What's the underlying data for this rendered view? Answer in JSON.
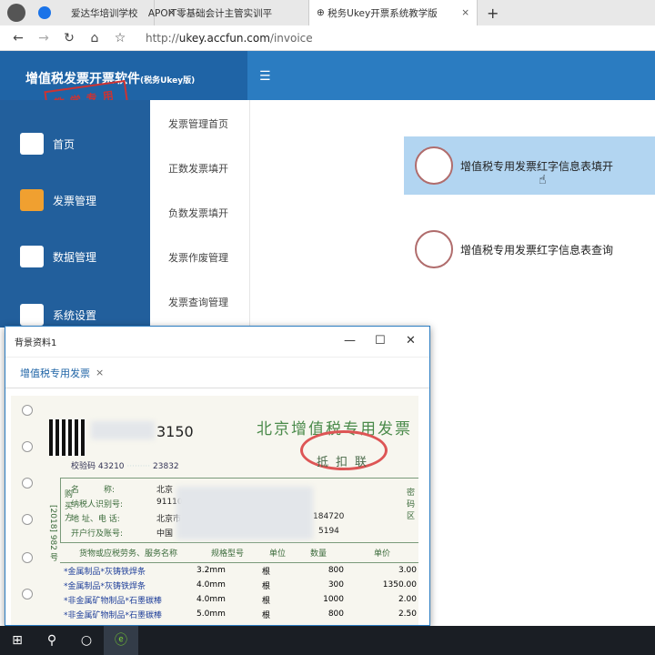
{
  "browser": {
    "tabs": [
      {
        "label": "爱达华培训学校"
      },
      {
        "label": "APOIT零基础会计主管实训平"
      },
      {
        "label": "税务Ukey开票系统教学版"
      }
    ],
    "url_prefix": "http://",
    "url_host": "ukey.accfun.com",
    "url_path": "/invoice"
  },
  "app": {
    "title": "增值税发票开票软件",
    "title_suffix": "(税务Ukey版)",
    "stamp": "教学专用"
  },
  "sidebar": {
    "items": [
      {
        "label": "首页"
      },
      {
        "label": "发票管理"
      },
      {
        "label": "数据管理"
      },
      {
        "label": "系统设置"
      }
    ]
  },
  "submenu": {
    "items": [
      {
        "label": "发票管理首页"
      },
      {
        "label": "正数发票填开"
      },
      {
        "label": "负数发票填开"
      },
      {
        "label": "发票作废管理"
      },
      {
        "label": "发票查询管理"
      }
    ]
  },
  "main": {
    "cards": [
      {
        "label": "增值税专用发票红字信息表填开"
      },
      {
        "label": "增值税专用发票红字信息表查询"
      }
    ]
  },
  "popup": {
    "title": "背景资料1",
    "tab": "增值税专用发票",
    "invoice": {
      "number_tail": "3150",
      "check_code_label": "校验码",
      "check_code_head": "43210",
      "check_code_tail": "23832",
      "title": "北京增值税专用发票",
      "copy": "抵扣联",
      "side_text": "[2018] 982 号",
      "buyer_label": "购买方",
      "code_area": "密码区",
      "buyer_fields": [
        {
          "label": "名　　　称:",
          "value": "北京"
        },
        {
          "label": "纳税人识别号:",
          "value": "91110"
        },
        {
          "label": "地 址、电 话:",
          "value": "北京市",
          "tail": "184720"
        },
        {
          "label": "开户行及账号:",
          "value": "中国",
          "tail": "5194"
        }
      ],
      "headers": [
        "货物或应税劳务、服务名称",
        "规格型号",
        "单位",
        "数量",
        "单价"
      ],
      "rows": [
        [
          "*金属制品*灰铸铁焊条",
          "3.2mm",
          "根",
          "800",
          "3.00"
        ],
        [
          "*金属制品*灰铸铁焊条",
          "4.0mm",
          "根",
          "300",
          "1350.00"
        ],
        [
          "*非金属矿物制品*石墨碳棒",
          "4.0mm",
          "根",
          "1000",
          "2.00"
        ],
        [
          "*非金属矿物制品*石墨碳棒",
          "5.0mm",
          "根",
          "800",
          "2.50"
        ]
      ]
    }
  }
}
